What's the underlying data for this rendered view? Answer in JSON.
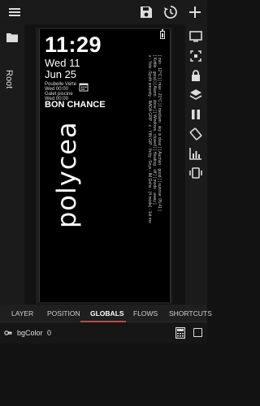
{
  "phone": {
    "time": "11:29",
    "date_line1": "Wed 11",
    "date_line2": "Jun 25",
    "events": [
      "Poubelle Verte",
      "Wed 00:00",
      "Galet piscine",
      "Wed 00:00"
    ],
    "message": "BON CHANCE",
    "logo": "polycea",
    "vertical_lines": [
      "[ min : 12°C ] [ max : 21°C ] [ medium : sky is clear ] [ Auchan : good ] [ sunrise: 05:41 ]",
      "[ Kettle : good ] [ Alarm : done ] [ Windows : closed ] [ Heating : off ] [ mode : away ]",
      "x - Yolo -Syoth amonity - BADA GRP - x - YIN GIP - Ihrby -Snyx - IM Dehs - [4 mode] - 1st mo"
    ]
  },
  "left_panel": {
    "root_label": "Root"
  },
  "tabs": [
    {
      "label": "LAYER",
      "active": false
    },
    {
      "label": "POSITION",
      "active": false
    },
    {
      "label": "GLOBALS",
      "active": true
    },
    {
      "label": "FLOWS",
      "active": false
    },
    {
      "label": "SHORTCUTS",
      "active": false
    }
  ],
  "globals": [
    {
      "name": "bgColor",
      "value": "0",
      "icon": "global-variable-icon"
    }
  ],
  "colors": {
    "accent": "#e53935",
    "background": "#121212"
  }
}
